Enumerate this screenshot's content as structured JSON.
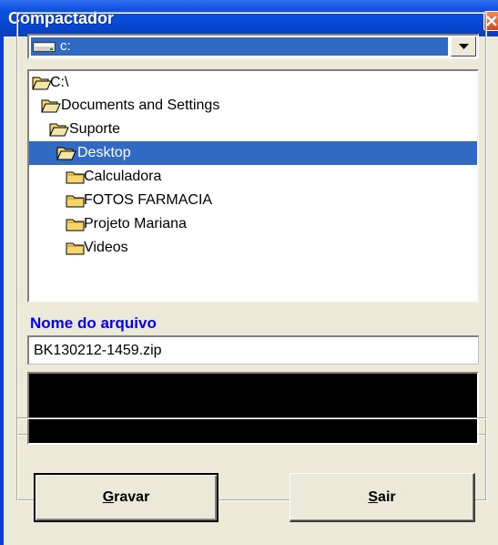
{
  "window": {
    "title": "Compactador",
    "close_icon": "close-icon"
  },
  "drive": {
    "selected": "c:",
    "icon": "drive-icon"
  },
  "directories": [
    {
      "label": "C:\\",
      "state": "open",
      "indent": 0
    },
    {
      "label": "Documents and Settings",
      "state": "open",
      "indent": 1
    },
    {
      "label": "Suporte",
      "state": "open",
      "indent": 2
    },
    {
      "label": "Desktop",
      "state": "open",
      "indent": 3,
      "selected": true
    },
    {
      "label": "Calculadora",
      "state": "closed",
      "indent": 4
    },
    {
      "label": "FOTOS FARMACIA",
      "state": "closed",
      "indent": 4
    },
    {
      "label": "Projeto Mariana",
      "state": "closed",
      "indent": 4
    },
    {
      "label": "Videos",
      "state": "closed",
      "indent": 4
    }
  ],
  "file": {
    "label": "Nome do arquivo",
    "value": "BK130212-1459.zip"
  },
  "buttons": {
    "save": {
      "prefix": "",
      "hotkey": "G",
      "rest": "ravar"
    },
    "exit": {
      "prefix": "",
      "hotkey": "S",
      "rest": "air"
    }
  },
  "colors": {
    "titlebar": "#0a3fd1",
    "selection": "#316ac5",
    "label_blue": "#0000ff",
    "face": "#ece9d8"
  }
}
